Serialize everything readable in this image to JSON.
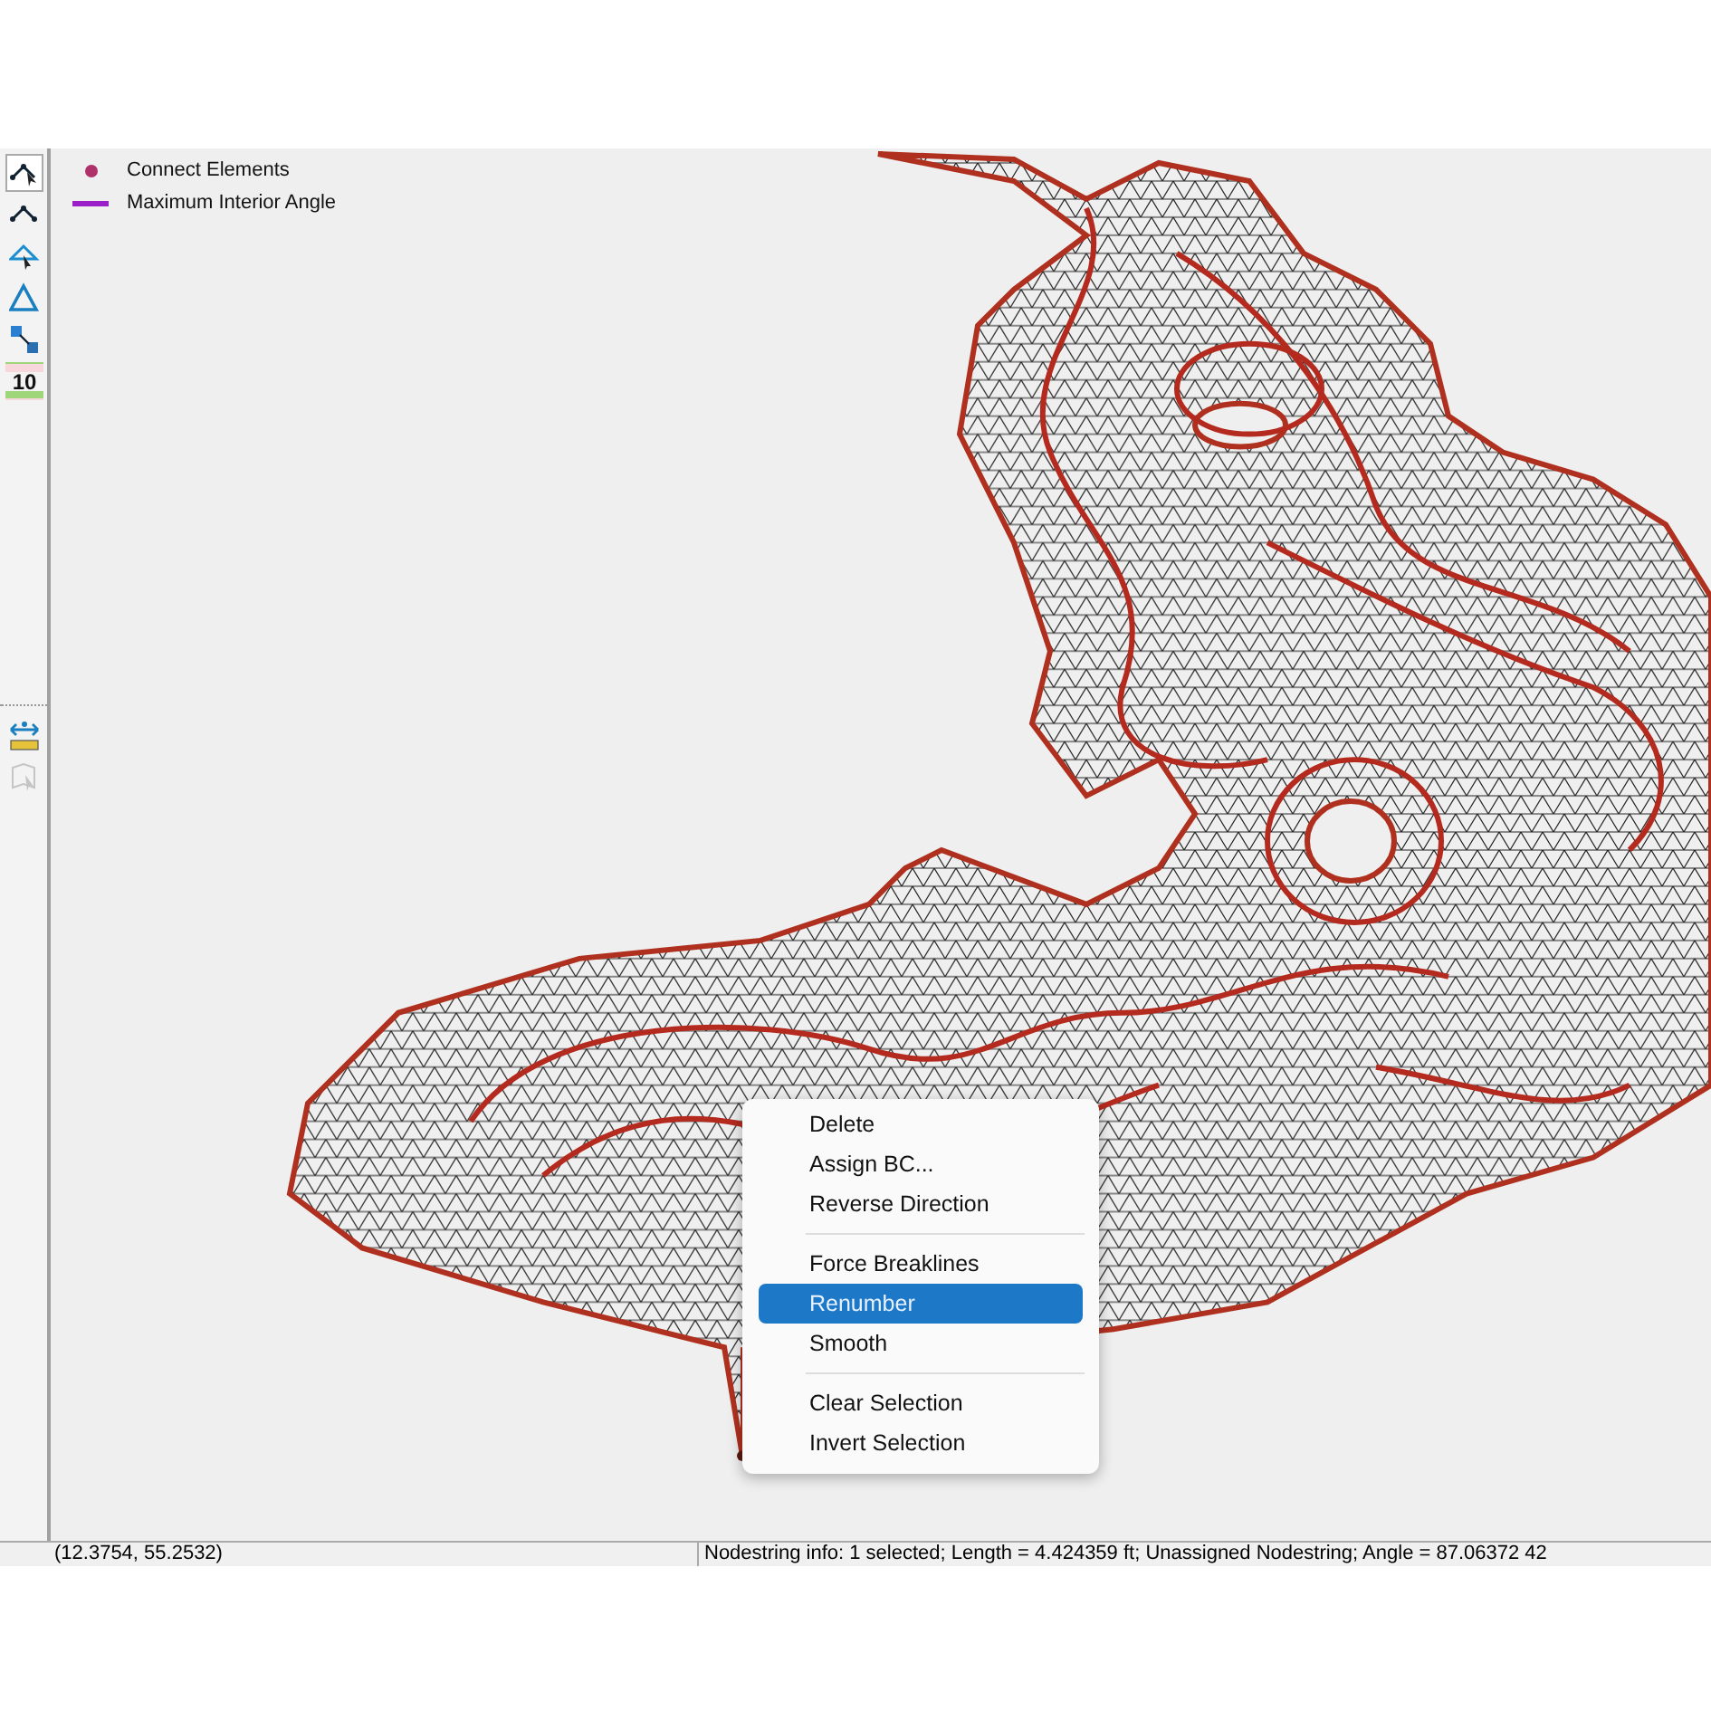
{
  "toolbar": {
    "groups": [
      {
        "tools": [
          {
            "kind": "arc-select",
            "selected": true
          },
          {
            "kind": "arc",
            "selected": false
          },
          {
            "kind": "triangle-select",
            "selected": false
          },
          {
            "kind": "triangle",
            "selected": false
          },
          {
            "kind": "squares",
            "selected": false
          },
          {
            "kind": "number",
            "label": "10",
            "selected": false
          }
        ]
      },
      {
        "tools": [
          {
            "kind": "ruler",
            "selected": false
          },
          {
            "kind": "map-select",
            "selected": false,
            "disabled": true
          }
        ]
      }
    ]
  },
  "legend": [
    {
      "kind": "dot",
      "label": "Connect Elements",
      "color": "#b0306a"
    },
    {
      "kind": "line",
      "label": "Maximum Interior Angle",
      "color": "#9b1fc9"
    }
  ],
  "context_menu": {
    "groups": [
      [
        {
          "label": "Delete",
          "selected": false
        },
        {
          "label": "Assign BC...",
          "selected": false
        },
        {
          "label": "Reverse Direction",
          "selected": false
        }
      ],
      [
        {
          "label": "Force Breaklines",
          "selected": false
        },
        {
          "label": "Renumber",
          "selected": true
        },
        {
          "label": "Smooth",
          "selected": false
        }
      ],
      [
        {
          "label": "Clear Selection",
          "selected": false
        },
        {
          "label": "Invert Selection",
          "selected": false
        }
      ]
    ]
  },
  "status_bar": {
    "coordinates": "(12.3754, 55.2532)",
    "info": "Nodestring info: 1 selected; Length = 4.424359 ft; Unassigned Nodestring; Angle = 87.06372 42"
  }
}
